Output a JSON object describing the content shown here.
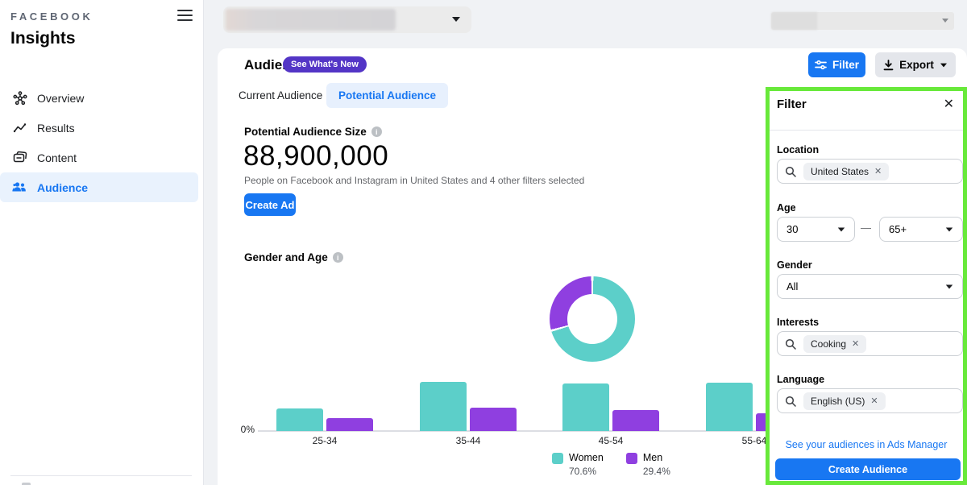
{
  "sidebar": {
    "logo": "FACEBOOK",
    "title": "Insights",
    "items": [
      {
        "label": "Overview",
        "icon": "network-icon",
        "active": false
      },
      {
        "label": "Results",
        "icon": "trend-icon",
        "active": false
      },
      {
        "label": "Content",
        "icon": "content-icon",
        "active": false
      },
      {
        "label": "Audience",
        "icon": "people-icon",
        "active": true
      }
    ]
  },
  "header": {
    "title": "Audience",
    "badge": "See What's New",
    "filter_button": "Filter",
    "export_button": "Export"
  },
  "tabs": {
    "current": "Current Audience",
    "potential": "Potential Audience"
  },
  "audience_size": {
    "label": "Potential Audience Size",
    "value": "88,900,000",
    "description": "People on Facebook and Instagram in United States and 4 other filters selected",
    "create_ad_button": "Create Ad"
  },
  "chart_section": {
    "title": "Gender and Age"
  },
  "chart_data": [
    {
      "type": "pie",
      "donut": true,
      "labels": [
        "Women",
        "Men"
      ],
      "values": [
        70.6,
        29.4
      ],
      "value_labels": [
        "70.6%",
        "29.4%"
      ],
      "colors": [
        "#5ccfc9",
        "#8f3fe0"
      ],
      "legend_position": "bottom"
    },
    {
      "type": "bar",
      "title": "Gender and Age",
      "categories": [
        "25-34",
        "35-44",
        "45-54",
        "55-64"
      ],
      "series": [
        {
          "name": "Women",
          "color": "#5ccfc9",
          "values": [
            9.7,
            21.0,
            20.3,
            20.7
          ]
        },
        {
          "name": "Men",
          "color": "#8f3fe0",
          "values": [
            5.5,
            10.0,
            8.9,
            7.5
          ]
        }
      ],
      "xlabel": "",
      "ylabel": "",
      "y_axis_labels": [
        "0%"
      ],
      "note": "Only the 0% gridline is labeled; bar values are percentages estimated from bar heights; the 55-64 group is partially covered by the filter panel overlay."
    }
  ],
  "filter_panel": {
    "title": "Filter",
    "location": {
      "label": "Location",
      "chip": "United States"
    },
    "age": {
      "label": "Age",
      "from": "30",
      "to": "65+",
      "separator": "—"
    },
    "gender": {
      "label": "Gender",
      "value": "All"
    },
    "interests": {
      "label": "Interests",
      "chip": "Cooking"
    },
    "language": {
      "label": "Language",
      "chip": "English (US)"
    },
    "link": "See your audiences in Ads Manager",
    "create_audience_button": "Create Audience"
  },
  "colors": {
    "accent_blue": "#1877f2",
    "badge_purple": "#5335c6",
    "women_teal": "#5ccfc9",
    "men_purple": "#8f3fe0",
    "highlight_green": "#68e93a",
    "page_bg": "#f0f2f5",
    "selected_tab_bg": "#e7f0fd"
  }
}
